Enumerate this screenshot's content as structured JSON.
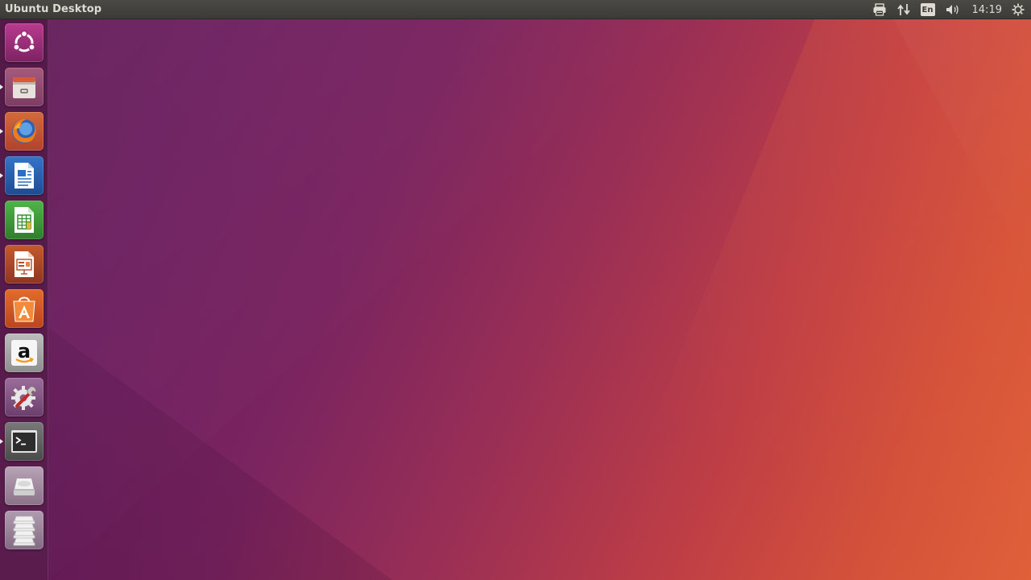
{
  "top_panel": {
    "window_title": "Ubuntu Desktop",
    "indicators": [
      {
        "name": "printer-icon"
      },
      {
        "name": "network-icon"
      },
      {
        "name": "keyboard-layout",
        "label": "En"
      },
      {
        "name": "volume-icon"
      },
      {
        "name": "clock",
        "label": "14:19"
      },
      {
        "name": "system-menu-icon"
      }
    ]
  },
  "launcher": {
    "items": [
      {
        "name": "dash-home",
        "icon": "ubuntu-logo-icon",
        "running": false
      },
      {
        "name": "files",
        "icon": "file-cabinet-icon",
        "running": true
      },
      {
        "name": "firefox",
        "icon": "firefox-icon",
        "running": true
      },
      {
        "name": "libreoffice-writer",
        "icon": "writer-doc-icon",
        "running": true
      },
      {
        "name": "libreoffice-calc",
        "icon": "calc-sheet-icon",
        "running": false
      },
      {
        "name": "libreoffice-impress",
        "icon": "impress-slide-icon",
        "running": false
      },
      {
        "name": "ubuntu-software",
        "icon": "shopping-bag-icon",
        "running": false
      },
      {
        "name": "amazon",
        "icon": "amazon-logo-icon",
        "running": false
      },
      {
        "name": "system-settings",
        "icon": "gear-wrench-icon",
        "running": false
      },
      {
        "name": "terminal",
        "icon": "terminal-prompt-icon",
        "running": true
      },
      {
        "name": "drive",
        "icon": "hard-drive-icon",
        "running": false
      },
      {
        "name": "workspaces",
        "icon": "workspaces-stack-icon",
        "running": false
      }
    ]
  },
  "colors": {
    "panel_bg": "#3c3b37",
    "panel_text": "#dfdbd2",
    "wallpaper_left": "#6c1f5f",
    "wallpaper_right": "#e0603a"
  }
}
